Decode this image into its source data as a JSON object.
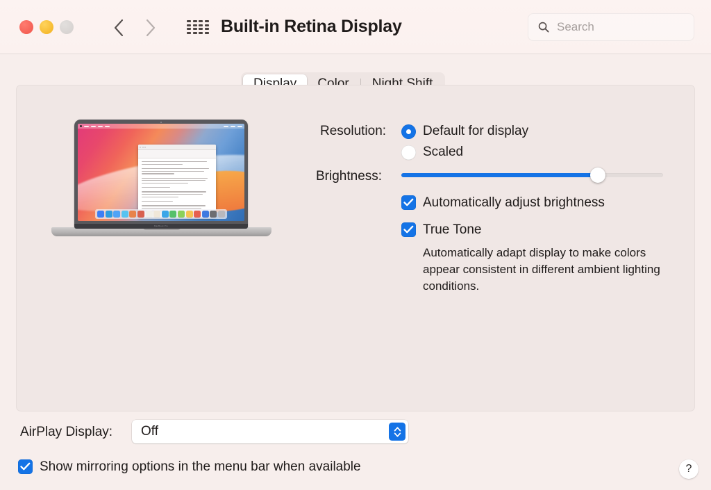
{
  "window": {
    "title": "Built-in Retina Display",
    "traffic_lights": [
      "close",
      "minimize",
      "zoom"
    ]
  },
  "toolbar": {
    "back_icon": "chevron-left-icon",
    "forward_icon": "chevron-right-icon",
    "grid_icon": "show-all-grid-icon",
    "search": {
      "placeholder": "Search",
      "value": "",
      "icon": "search-icon"
    }
  },
  "tabs": [
    {
      "label": "Display",
      "selected": true
    },
    {
      "label": "Color",
      "selected": false
    },
    {
      "label": "Night Shift",
      "selected": false
    }
  ],
  "preview": {
    "device": "MacBook Pro",
    "alt": "Built-in Retina Display preview"
  },
  "settings": {
    "resolution": {
      "label": "Resolution:",
      "options": [
        {
          "label": "Default for display",
          "selected": true
        },
        {
          "label": "Scaled",
          "selected": false
        }
      ]
    },
    "brightness": {
      "label": "Brightness:",
      "value_percent": 75
    },
    "auto_brightness": {
      "label": "Automatically adjust brightness",
      "checked": true
    },
    "true_tone": {
      "label": "True Tone",
      "checked": true,
      "description": "Automatically adapt display to make colors appear consistent in different ambient lighting conditions."
    }
  },
  "bottom": {
    "airplay_label": "AirPlay Display:",
    "airplay_value": "Off",
    "mirroring": {
      "label": "Show mirroring options in the menu bar when available",
      "checked": true
    },
    "help_label": "?"
  },
  "colors": {
    "accent": "#1473e6",
    "window_bg": "#f7eeec",
    "panel_bg": "#f0e7e5",
    "titlebar_bg": "#fcf3f1",
    "text": "#1f1b1a",
    "close": "#f0564c",
    "minimize": "#f2b01d",
    "zoom_disabled": "#d3cfcd"
  }
}
